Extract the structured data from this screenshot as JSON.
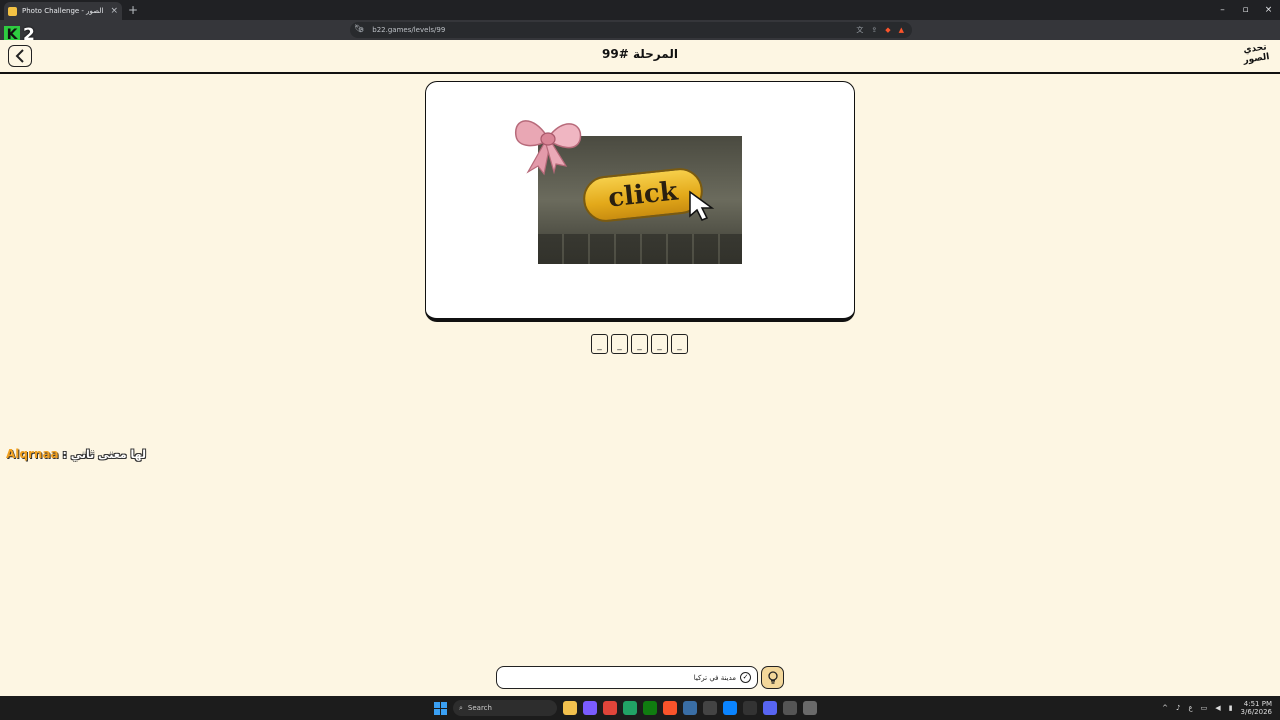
{
  "browser": {
    "tab_title": "Photo Challenge - تحدي الصور",
    "tab_close": "×",
    "new_tab": "+",
    "url": "b22.games/levels/99",
    "window_controls": [
      "–",
      "▫",
      "×"
    ]
  },
  "overlay": {
    "k_letter": "K",
    "counter": "2"
  },
  "header": {
    "level_title": "المرحلة #99",
    "logo_text": "تحدي الصور"
  },
  "puzzle": {
    "image_text": "click",
    "slots": [
      "_",
      "_",
      "_",
      "_",
      "_"
    ]
  },
  "chat": {
    "username": "Alqrnaa",
    "separator": " : ",
    "message": "لها معنى ثاني"
  },
  "hint": {
    "text": "مدينة في تركيا",
    "check_symbol": "✓"
  },
  "taskbar": {
    "search_placeholder": "Search",
    "time": "4:51 PM",
    "date": "3/6/2026"
  },
  "colors": {
    "page_background": "#fdf6e3",
    "accent_gold": "#e3a91a",
    "chat_username": "#f0a020",
    "hint_button": "#f3d79a"
  }
}
